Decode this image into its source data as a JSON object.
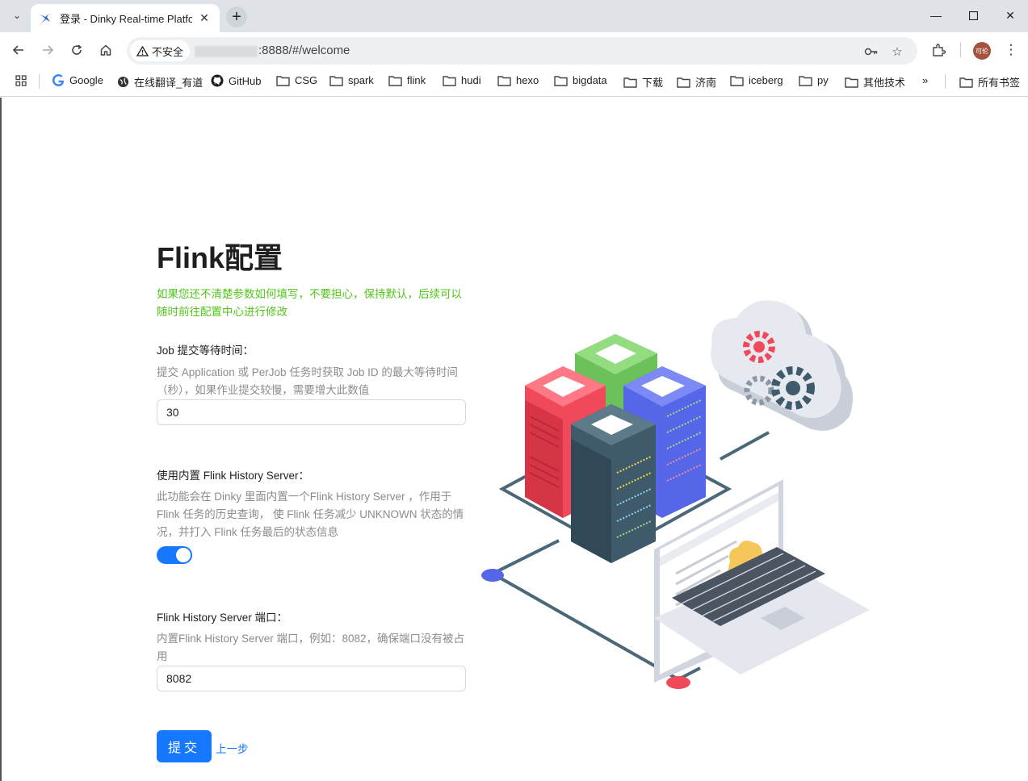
{
  "browser": {
    "tab_title": "登录 - Dinky Real-time Platfor",
    "security_label": "不安全",
    "url": ":8888/#/welcome",
    "profile_initials": "可伦"
  },
  "bookmarks": {
    "items": [
      "Google",
      "在线翻译_有道",
      "GitHub",
      "CSG",
      "spark",
      "flink",
      "hudi",
      "hexo",
      "bigdata",
      "下载",
      "济南",
      "iceberg",
      "py",
      "其他技术"
    ],
    "overflow": "»",
    "all_bookmarks": "所有书签"
  },
  "form": {
    "title": "Flink配置",
    "hint": "如果您还不清楚参数如何填写，不要担心，保持默认，后续可以随时前往配置中心进行修改",
    "job_wait": {
      "label": "Job 提交等待时间：",
      "description": "提交 Application 或 PerJob 任务时获取 Job ID 的最大等待时间（秒），如果作业提交较慢，需要增大此数值",
      "value": "30"
    },
    "history_server": {
      "label": "使用内置 Flink History Server：",
      "description": "此功能会在 Dinky 里面内置一个Flink History Server ，作用于 Flink 任务的历史查询， 使 Flink 任务减少 UNKNOWN 状态的情况，并打入 Flink 任务最后的状态信息",
      "enabled": true
    },
    "history_port": {
      "label": "Flink History Server 端口：",
      "description": "内置Flink History Server 端口，例如：8082，确保端口没有被占用",
      "value": "8082"
    },
    "submit_label": "提交",
    "prev_label": "上一步"
  },
  "colors": {
    "primary": "#1677ff",
    "hint_green": "#52c41a",
    "server_red": "#f04a5a",
    "server_green": "#7dd36a",
    "server_blue": "#5566e8",
    "server_dark": "#3f5a6b"
  }
}
